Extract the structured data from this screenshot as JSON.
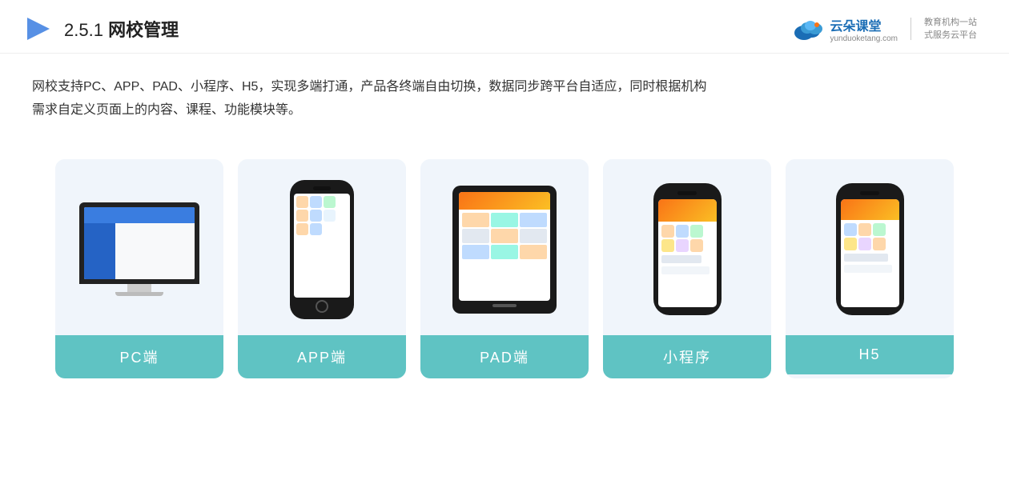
{
  "header": {
    "section_num": "2.5.1",
    "title": "网校管理",
    "logo": {
      "main": "云朵课堂",
      "domain": "yunduoketang.com",
      "slogan_line1": "教育机构一站",
      "slogan_line2": "式服务云平台"
    }
  },
  "description": {
    "line1": "网校支持PC、APP、PAD、小程序、H5，实现多端打通，产品各终端自由切换，数据同步跨平台自适应，同时根据机构",
    "line2": "需求自定义页面上的内容、课程、功能模块等。"
  },
  "cards": [
    {
      "id": "pc",
      "label": "PC端"
    },
    {
      "id": "app",
      "label": "APP端"
    },
    {
      "id": "pad",
      "label": "PAD端"
    },
    {
      "id": "miniapp",
      "label": "小程序"
    },
    {
      "id": "h5",
      "label": "H5"
    }
  ]
}
